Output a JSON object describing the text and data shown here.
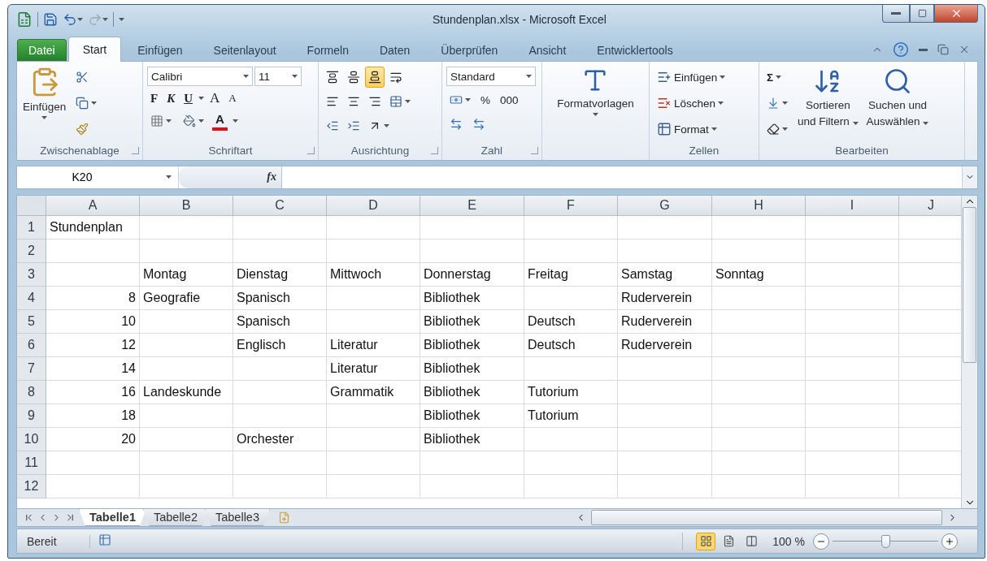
{
  "window": {
    "title": "Stundenplan.xlsx - Microsoft Excel"
  },
  "ribbon_tabs": [
    {
      "label": "Datei",
      "kind": "file",
      "selected": false
    },
    {
      "label": "Start",
      "kind": "tab",
      "selected": true
    },
    {
      "label": "Einfügen",
      "kind": "tab",
      "selected": false
    },
    {
      "label": "Seitenlayout",
      "kind": "tab",
      "selected": false
    },
    {
      "label": "Formeln",
      "kind": "tab",
      "selected": false
    },
    {
      "label": "Daten",
      "kind": "tab",
      "selected": false
    },
    {
      "label": "Überprüfen",
      "kind": "tab",
      "selected": false
    },
    {
      "label": "Ansicht",
      "kind": "tab",
      "selected": false
    },
    {
      "label": "Entwicklertools",
      "kind": "tab",
      "selected": false
    }
  ],
  "clipboard": {
    "label": "Zwischenablage",
    "paste": "Einfügen",
    "launcher": true
  },
  "font": {
    "label": "Schriftart",
    "family": "Calibri",
    "size": "11",
    "bold": "F",
    "italic": "K",
    "underline": "U",
    "grow": "A",
    "shrink": "A",
    "font_color_button": "A",
    "launcher": true
  },
  "alignment": {
    "label": "Ausrichtung",
    "launcher": true,
    "vertical": [
      {
        "kind": "top",
        "selected": false
      },
      {
        "kind": "middle",
        "selected": false
      },
      {
        "kind": "bottom",
        "selected": true
      }
    ]
  },
  "number": {
    "label": "Zahl",
    "format": "Standard",
    "percent": "%",
    "thousands": "000",
    "launcher": true
  },
  "styles": {
    "label": "Formatvorlagen"
  },
  "cells_group": {
    "label": "Zellen",
    "commands": [
      "Einfügen",
      "Löschen",
      "Format"
    ]
  },
  "editing": {
    "label": "Bearbeiten",
    "sum": "Σ",
    "sort": [
      "Sortieren",
      "und Filtern"
    ],
    "find": [
      "Suchen und",
      "Auswählen"
    ]
  },
  "formula_bar": {
    "name_box": "K20",
    "function_label": "fx"
  },
  "sheet": {
    "columns": [
      "A",
      "B",
      "C",
      "D",
      "E",
      "F",
      "G",
      "H",
      "I",
      "J"
    ],
    "rows": [
      {
        "header": "1",
        "cells": [
          "Stundenplan",
          null,
          null,
          null,
          null,
          null,
          null,
          null,
          null,
          null
        ]
      },
      {
        "header": "2",
        "cells": [
          null,
          null,
          null,
          null,
          null,
          null,
          null,
          null,
          null,
          null
        ]
      },
      {
        "header": "3",
        "cells": [
          null,
          "Montag",
          "Dienstag",
          "Mittwoch",
          "Donnerstag",
          "Freitag",
          "Samstag",
          "Sonntag",
          null,
          null
        ]
      },
      {
        "header": "4",
        "cells": [
          "8",
          "Geografie",
          "Spanisch",
          null,
          "Bibliothek",
          null,
          "Ruderverein",
          null,
          null,
          null
        ]
      },
      {
        "header": "5",
        "cells": [
          "10",
          null,
          "Spanisch",
          null,
          "Bibliothek",
          "Deutsch",
          "Ruderverein",
          null,
          null,
          null
        ]
      },
      {
        "header": "6",
        "cells": [
          "12",
          null,
          "Englisch",
          "Literatur",
          "Bibliothek",
          "Deutsch",
          "Ruderverein",
          null,
          null,
          null
        ]
      },
      {
        "header": "7",
        "cells": [
          "14",
          null,
          null,
          "Literatur",
          "Bibliothek",
          null,
          null,
          null,
          null,
          null
        ]
      },
      {
        "header": "8",
        "cells": [
          "16",
          "Landeskunde",
          null,
          "Grammatik",
          "Bibliothek",
          "Tutorium",
          null,
          null,
          null,
          null
        ]
      },
      {
        "header": "9",
        "cells": [
          "18",
          null,
          null,
          null,
          "Bibliothek",
          "Tutorium",
          null,
          null,
          null,
          null
        ]
      },
      {
        "header": "10",
        "cells": [
          "20",
          null,
          "Orchester",
          null,
          "Bibliothek",
          null,
          null,
          null,
          null,
          null
        ]
      },
      {
        "header": "11",
        "cells": [
          null,
          null,
          null,
          null,
          null,
          null,
          null,
          null,
          null,
          null
        ]
      },
      {
        "header": "12",
        "cells": [
          null,
          null,
          null,
          null,
          null,
          null,
          null,
          null,
          null,
          null
        ]
      }
    ]
  },
  "sheet_tabs": [
    {
      "label": "Tabelle1",
      "selected": true
    },
    {
      "label": "Tabelle2",
      "selected": false
    },
    {
      "label": "Tabelle3",
      "selected": false
    }
  ],
  "status_bar": {
    "text": "Bereit",
    "views": [
      {
        "kind": "normal",
        "selected": true
      },
      {
        "kind": "layout",
        "selected": false
      },
      {
        "kind": "pagebreak",
        "selected": false
      }
    ],
    "zoom": "100 %",
    "zoom_slider": {
      "level": 0.5
    }
  }
}
